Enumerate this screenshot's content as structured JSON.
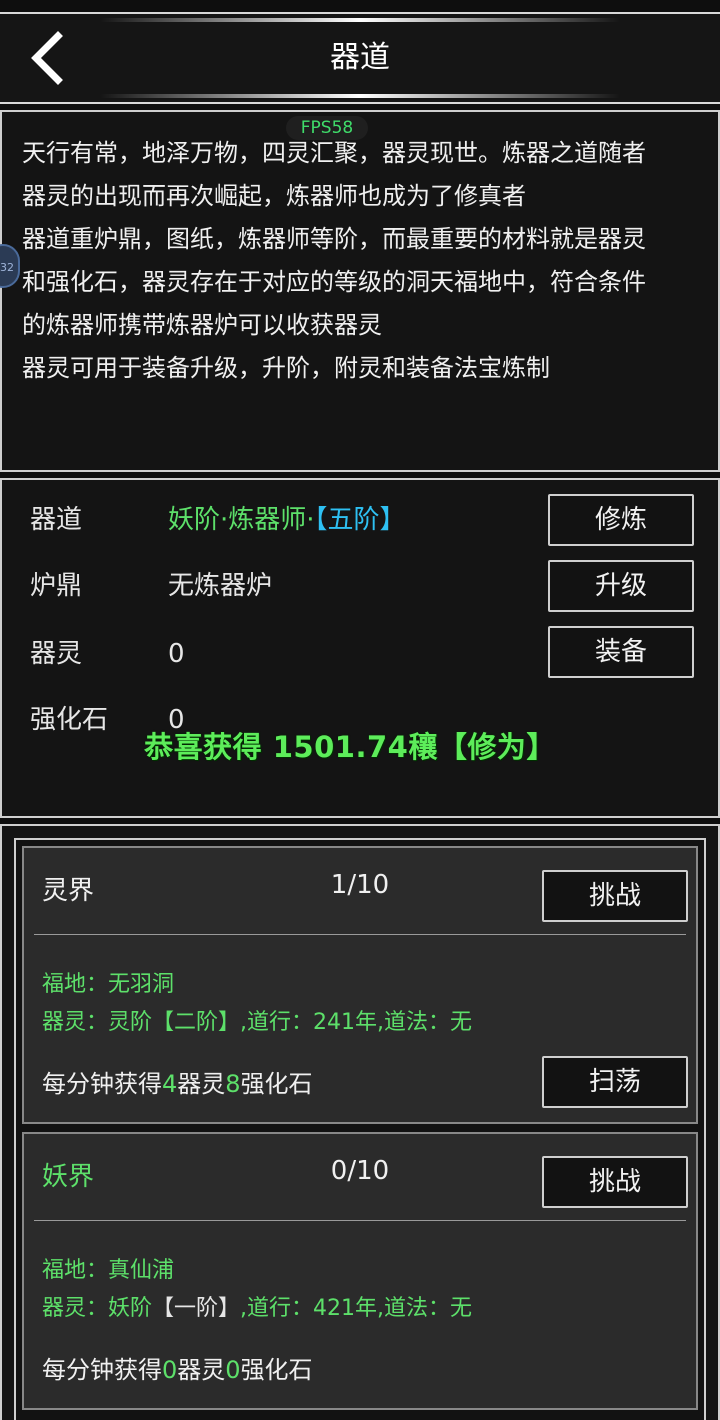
{
  "header": {
    "title": "器道"
  },
  "overlay": {
    "fps": "FPS58",
    "side_badge": "32"
  },
  "description": [
    "天行有常，地泽万物，四灵汇聚，器灵现世。炼器之道随者",
    "器灵的出现而再次崛起，炼器师也成为了修真者",
    "器道重炉鼎，图纸，炼器师等阶，而最重要的材料就是器灵",
    "和强化石，器灵存在于对应的等级的洞天福地中，符合条件",
    "的炼器师携带炼器炉可以收获器灵",
    "器灵可用于装备升级，升阶，附灵和装备法宝炼制"
  ],
  "stats": {
    "qidao": {
      "label": "器道",
      "value_main": "妖阶·炼器师·",
      "value_tier": "【五阶】",
      "button": "修炼"
    },
    "luding": {
      "label": "炉鼎",
      "value": "无炼器炉",
      "button": "升级"
    },
    "qiling": {
      "label": "器灵",
      "value": "0",
      "button": "装备"
    },
    "qianghuashi": {
      "label": "强化石",
      "value": "0"
    }
  },
  "toast": "恭喜获得 1501.74穰【修为】",
  "realms": [
    {
      "name": "灵界",
      "count": "1/10",
      "challenge": "挑战",
      "fudi": "福地：无羽洞",
      "qiling_prefix": "器灵：灵阶",
      "qiling_tier": "【二阶】",
      "qiling_suffix": ",道行：241年,道法：无",
      "earn_prefix": "每分钟获得",
      "earn_qiling": "4",
      "earn_mid": "器灵",
      "earn_stone": "8",
      "earn_suffix": "强化石",
      "sweep": "扫荡"
    },
    {
      "name": "妖界",
      "count": "0/10",
      "challenge": "挑战",
      "fudi": "福地：真仙浦",
      "qiling_prefix": "器灵：妖阶",
      "qiling_tier": "【一阶】",
      "qiling_suffix": ",道行：421年,道法：无",
      "earn_prefix": "每分钟获得",
      "earn_qiling": "0",
      "earn_mid": "器灵",
      "earn_stone": "0",
      "earn_suffix": "强化石"
    }
  ],
  "colors": {
    "green": "#5de06a",
    "blue": "#2ec0f2",
    "toast_green": "#5ded5a",
    "border": "#cfcfcf",
    "card_bg": "#2b2b2b"
  }
}
